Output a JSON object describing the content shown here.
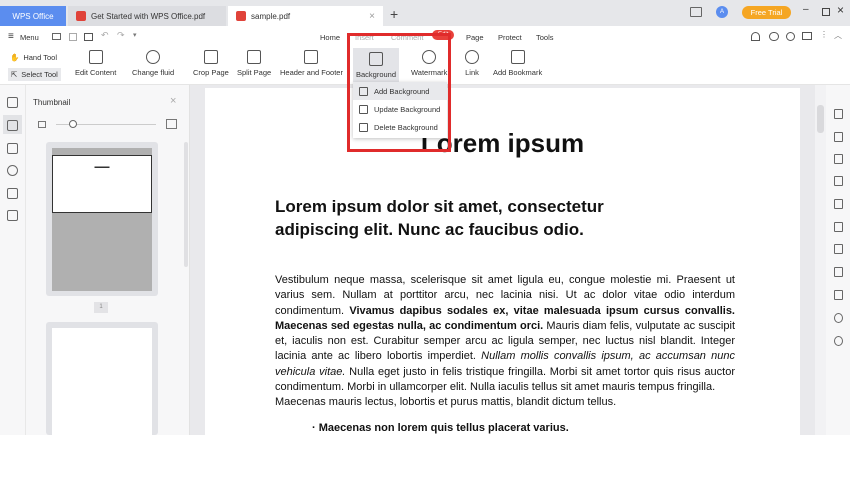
{
  "titlebar": {
    "home_tab": "WPS Office",
    "tabs": [
      {
        "label": "Get Started with WPS Office.pdf"
      },
      {
        "label": "sample.pdf",
        "active": true
      }
    ],
    "free_trial": "Free Trial",
    "avatar_initial": "A"
  },
  "menubar": {
    "menu_label": "Menu",
    "nav_tabs": [
      "Home",
      "Insert",
      "Comment",
      "Edit",
      "Page",
      "Protect",
      "Tools"
    ],
    "active_tab": "Edit"
  },
  "ribbon": {
    "hand_tool": "Hand Tool",
    "select_tool": "Select Tool",
    "buttons": [
      "Edit Content",
      "Change fluid",
      "Crop Page",
      "Split Page",
      "Header and Footer",
      "Background",
      "Watermark",
      "Link",
      "Add Bookmark"
    ]
  },
  "dropdown": {
    "items": [
      "Add Background",
      "Update Background",
      "Delete Background"
    ]
  },
  "thumbnail": {
    "title": "Thumbnail",
    "page_label": "1",
    "zoom_level": 0.1
  },
  "document": {
    "title": "Lorem ipsum",
    "heading": "Lorem ipsum dolor sit amet, consectetur adipiscing elit. Nunc ac faucibus odio.",
    "p1_a": "Vestibulum neque massa, scelerisque sit amet ligula eu, congue molestie mi. Praesent ut varius sem. Nullam at porttitor arcu, nec lacinia nisi. Ut ac dolor vitae odio interdum condimentum. ",
    "p1_b": "Vivamus dapibus sodales ex, vitae malesuada ipsum cursus convallis. Maecenas sed egestas nulla, ac condimentum orci.",
    "p1_c": " Mauris diam felis, vulputate ac suscipit et, iaculis non est. Curabitur semper arcu ac ligula semper, nec luctus nisl blandit. Integer lacinia ante ac libero lobortis imperdiet. ",
    "p1_d": "Nullam mollis convallis ipsum, ac accumsan nunc vehicula vitae.",
    "p1_e": " Nulla eget justo in felis tristique fringilla. Morbi sit amet tortor quis risus auctor condimentum. Morbi in ullamcorper elit. Nulla iaculis tellus sit amet mauris tempus fringilla.",
    "p2": "Maecenas mauris lectus, lobortis et purus mattis, blandit dictum tellus.",
    "bullet": "Maecenas non lorem quis tellus placerat varius."
  },
  "colors": {
    "accent": "#e02b2b",
    "wps_blue": "#5b8def",
    "trial": "#f5a623"
  }
}
